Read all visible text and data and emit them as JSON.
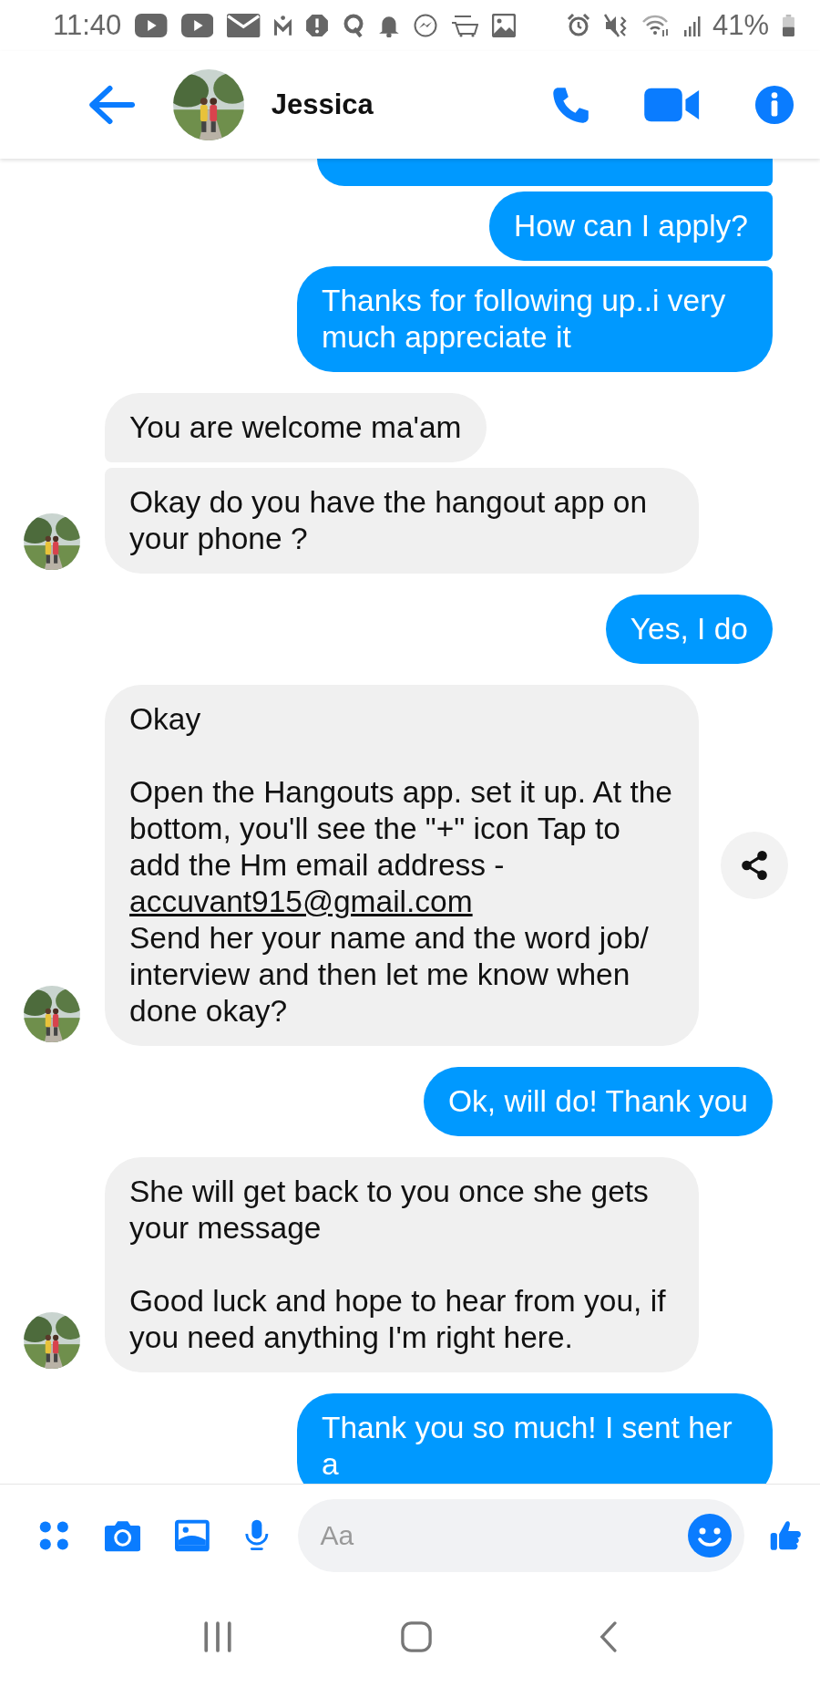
{
  "status_bar": {
    "time": "11:40",
    "battery": "41%"
  },
  "header": {
    "name": "Jessica"
  },
  "messages": [
    {
      "kind": "stub"
    },
    {
      "kind": "sent",
      "paragraphs": [
        [
          {
            "kind": "text",
            "text": "How can I apply?"
          }
        ]
      ]
    },
    {
      "kind": "sent",
      "paragraphs": [
        [
          {
            "kind": "text",
            "text": "Thanks for following up..i very much appreciate it"
          }
        ]
      ]
    },
    {
      "kind": "received",
      "paragraphs": [
        [
          {
            "kind": "text",
            "text": "You are welcome ma'am"
          }
        ]
      ]
    },
    {
      "kind": "received",
      "paragraphs": [
        [
          {
            "kind": "text",
            "text": "Okay do you have the hangout app on your phone ?"
          }
        ]
      ]
    },
    {
      "kind": "sent",
      "paragraphs": [
        [
          {
            "kind": "text",
            "text": "Yes, I do"
          }
        ]
      ]
    },
    {
      "kind": "received",
      "share_button": true,
      "paragraphs": [
        [
          {
            "kind": "text",
            "text": "Okay"
          }
        ],
        [
          {
            "kind": "text",
            "text": "Open the Hangouts app. set it up. At the bottom, you'll see the \"+\" icon Tap to add the Hm email address -"
          },
          {
            "kind": "link",
            "text": "accuvant915@gmail.com"
          },
          {
            "kind": "text",
            "text": "Send her your name and the word job/ interview and then let me know when done okay?"
          }
        ]
      ]
    },
    {
      "kind": "sent",
      "paragraphs": [
        [
          {
            "kind": "text",
            "text": "Ok, will do! Thank you"
          }
        ]
      ]
    },
    {
      "kind": "received",
      "paragraphs": [
        [
          {
            "kind": "text",
            "text": "She will get back to you once she gets your message"
          }
        ],
        [
          {
            "kind": "text",
            "text": "Good luck and hope to hear from you, if you need anything I'm right here."
          }
        ]
      ]
    },
    {
      "kind": "sent",
      "paragraphs": [
        [
          {
            "kind": "text",
            "text": "Thank you so much! I sent her a"
          }
        ]
      ]
    }
  ],
  "composer": {
    "placeholder": "Aa"
  }
}
